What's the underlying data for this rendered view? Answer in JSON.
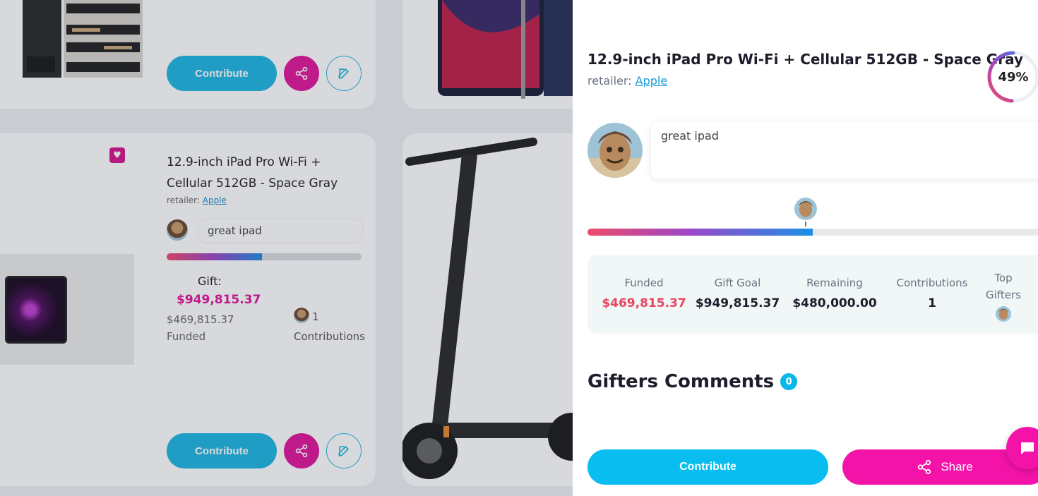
{
  "background": {
    "cards": [
      {
        "contribute_label": "Contribute"
      },
      {
        "title": "12.9-inch iPad Pro Wi-Fi + Cellular 512GB - Space Gray",
        "retailer_prefix": "retailer:",
        "retailer_name": "Apple",
        "message": "great ipad",
        "progress": 0.49,
        "gift_label": "Gift:",
        "gift_value": "$949,815.37",
        "funded_value": "$469,815.37",
        "funded_label": "Funded",
        "contributions_count": "1",
        "contributions_label": "Contributions",
        "contribute_label": "Contribute"
      }
    ]
  },
  "drawer": {
    "title": "12.9-inch iPad Pro Wi-Fi + Cellular 512GB - Space Gray",
    "retailer_prefix": "retailer:",
    "retailer_name": "Apple",
    "percent_label": "49%",
    "percent": 49,
    "message": "great ipad",
    "progress": 0.49,
    "stats": {
      "funded_label": "Funded",
      "funded_value": "$469,815.37",
      "goal_label": "Gift Goal",
      "goal_value": "$949,815.37",
      "remaining_label": "Remaining",
      "remaining_value": "$480,000.00",
      "contributions_label": "Contributions",
      "contributions_value": "1",
      "top_gifters_label_1": "Top",
      "top_gifters_label_2": "Gifters"
    },
    "comments_heading": "Gifters Comments",
    "comments_count": "0",
    "contribute_label": "Contribute",
    "share_label": "Share"
  },
  "colors": {
    "accent_cyan": "#09bdf0",
    "accent_pink": "#f313a8",
    "funded_red": "#e84560"
  },
  "icons": [
    "share-icon",
    "edit-icon",
    "heart-icon",
    "chat-icon"
  ]
}
